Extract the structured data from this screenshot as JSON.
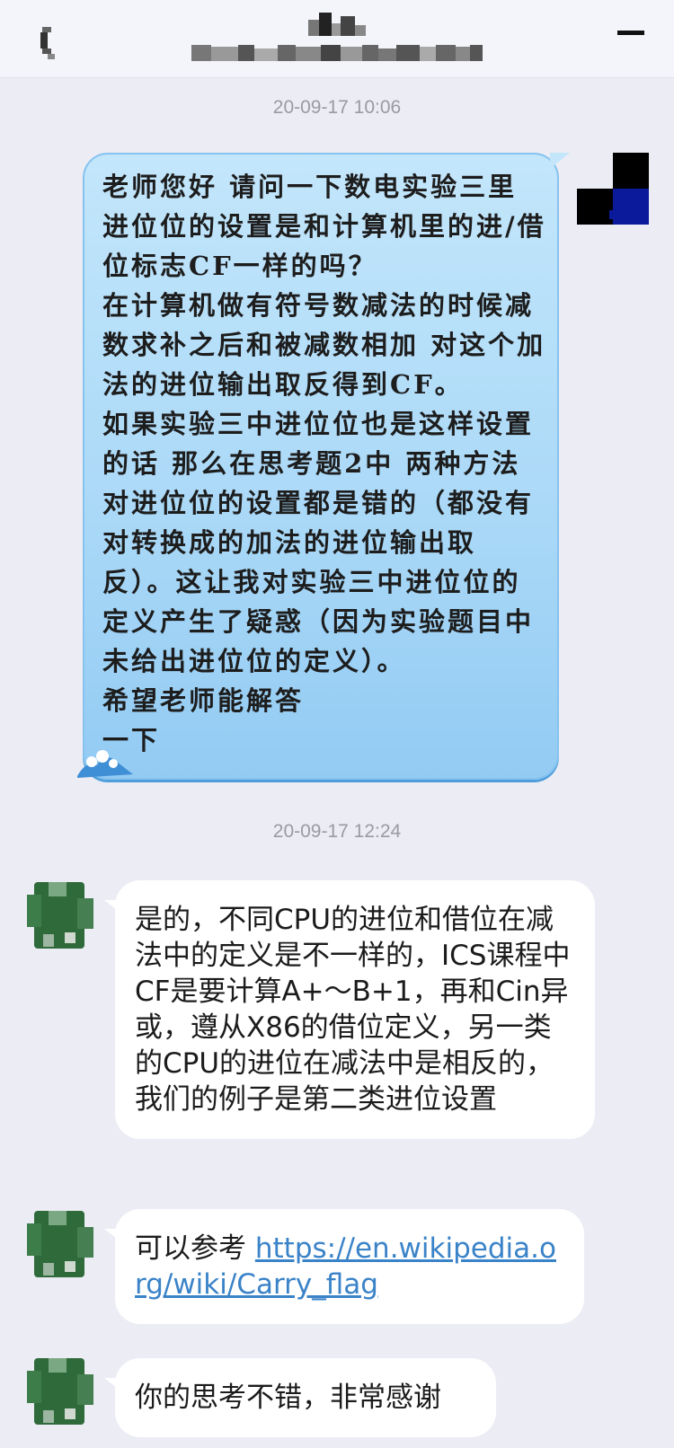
{
  "header": {
    "back_icon": "chevron-left-icon",
    "menu_icon": "menu-icon"
  },
  "messages": {
    "timestamp_1": "20-09-17 10:06",
    "outgoing_text": "老师您好 请问一下数电实验三里 进位位的设置是和计算机里的进/借位标志CF一样的吗？\n在计算机做有符号数减法的时候减数求补之后和被减数相加 对这个加法的进位输出取反得到CF。\n如果实验三中进位位也是这样设置的话 那么在思考题2中 两种方法对进位位的设置都是错的（都没有对转换成的加法的进位输出取反）。这让我对实验三中进位位的定义产生了疑惑（因为实验题目中未给出进位位的定义）。\n希望老师能解答\n一下",
    "timestamp_2": "20-09-17 12:24",
    "incoming_1": "是的，不同CPU的进位和借位在减法中的定义是不一样的，ICS课程中CF是要计算A+～B+1，再和Cin异或，遵从X86的借位定义，另一类的CPU的进位在减法中是相反的，我们的例子是第二类进位设置",
    "incoming_2_prefix": "可以参考 ",
    "incoming_2_link": "https://en.wikipedia.org/wiki/Carry_flag",
    "incoming_3": "你的思考不错，非常感谢"
  },
  "colors": {
    "background": "#ececf5",
    "outgoing_bubble": "#a9d8f7",
    "incoming_bubble": "#ffffff",
    "link": "#3a83c8"
  }
}
